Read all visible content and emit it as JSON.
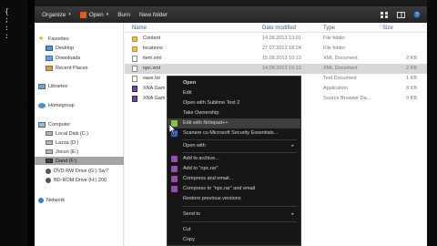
{
  "colors": {
    "toolbar": "#2b2b2b",
    "selection": "#a3a3a3",
    "menu_bg": "#161616",
    "menu_highlight": "#3d3d3d",
    "header_text": "#4a5c78"
  },
  "side_glyph": "{\n;\n:\n:",
  "toolbar": {
    "organize_label": "Organize",
    "open_label": "Open",
    "burn_label": "Burn",
    "new_folder_label": "New folder",
    "caret": "▾"
  },
  "nav": {
    "favorites": "Favorites",
    "desktop": "Desktop",
    "downloads": "Downloads",
    "recent": "Recent Places",
    "libraries": "Libraries",
    "homegroup": "Homegroup",
    "computer": "Computer",
    "drive_c": "Local Disk (C:)",
    "drive_d": "Lazza (D:)",
    "drive_e": "Jocuri (E:)",
    "drive_f": "Dand (F:)",
    "drive_g": "DVD RW Drive (G:) Sw?",
    "drive_h": "BD-ROM Drive (H:) 200",
    "network": "Network"
  },
  "columns": {
    "name": "Name",
    "date": "Date modified",
    "type": "Type",
    "size": "Size"
  },
  "files": [
    {
      "name": "Content",
      "date": "14.08.2013 13:01",
      "type": "File folder",
      "size": ""
    },
    {
      "name": "locations",
      "date": "27.07.2013 18:24",
      "type": "File folder",
      "size": ""
    },
    {
      "name": "item.xml",
      "date": "15.08.2013 16:13",
      "type": "XML Document",
      "size": "2 KB"
    },
    {
      "name": "npc.xml",
      "date": "14.08.2013 16:13",
      "type": "XML Document",
      "size": "2 KB"
    },
    {
      "name": "save.txt",
      "date": "",
      "type": "Text Document",
      "size": "1 KB"
    },
    {
      "name": "XNA Gam",
      "date": "",
      "type": "Application",
      "size": "8 KB"
    },
    {
      "name": "XNA Gam",
      "date": "",
      "type": "Source Browser Da...",
      "size": "0 KB"
    }
  ],
  "context_menu": {
    "open": "Open",
    "edit": "Edit",
    "open_sublime": "Open with Sublime Text 2",
    "take_ownership": "Take Ownership",
    "edit_notepad": "Edit with Notepad++",
    "scan": "Scanare cu Microsoft Security Essentials...",
    "open_with": "Open with",
    "add_archive": "Add to archive...",
    "add_rar": "Add to \"npc.rar\"",
    "compress_email": "Compress and email...",
    "compress_rar_email": "Compress to \"npc.rar\" and email",
    "restore": "Restore previous versions",
    "send_to": "Send to",
    "cut": "Cut",
    "copy": "Copy",
    "arrow": "▸"
  }
}
